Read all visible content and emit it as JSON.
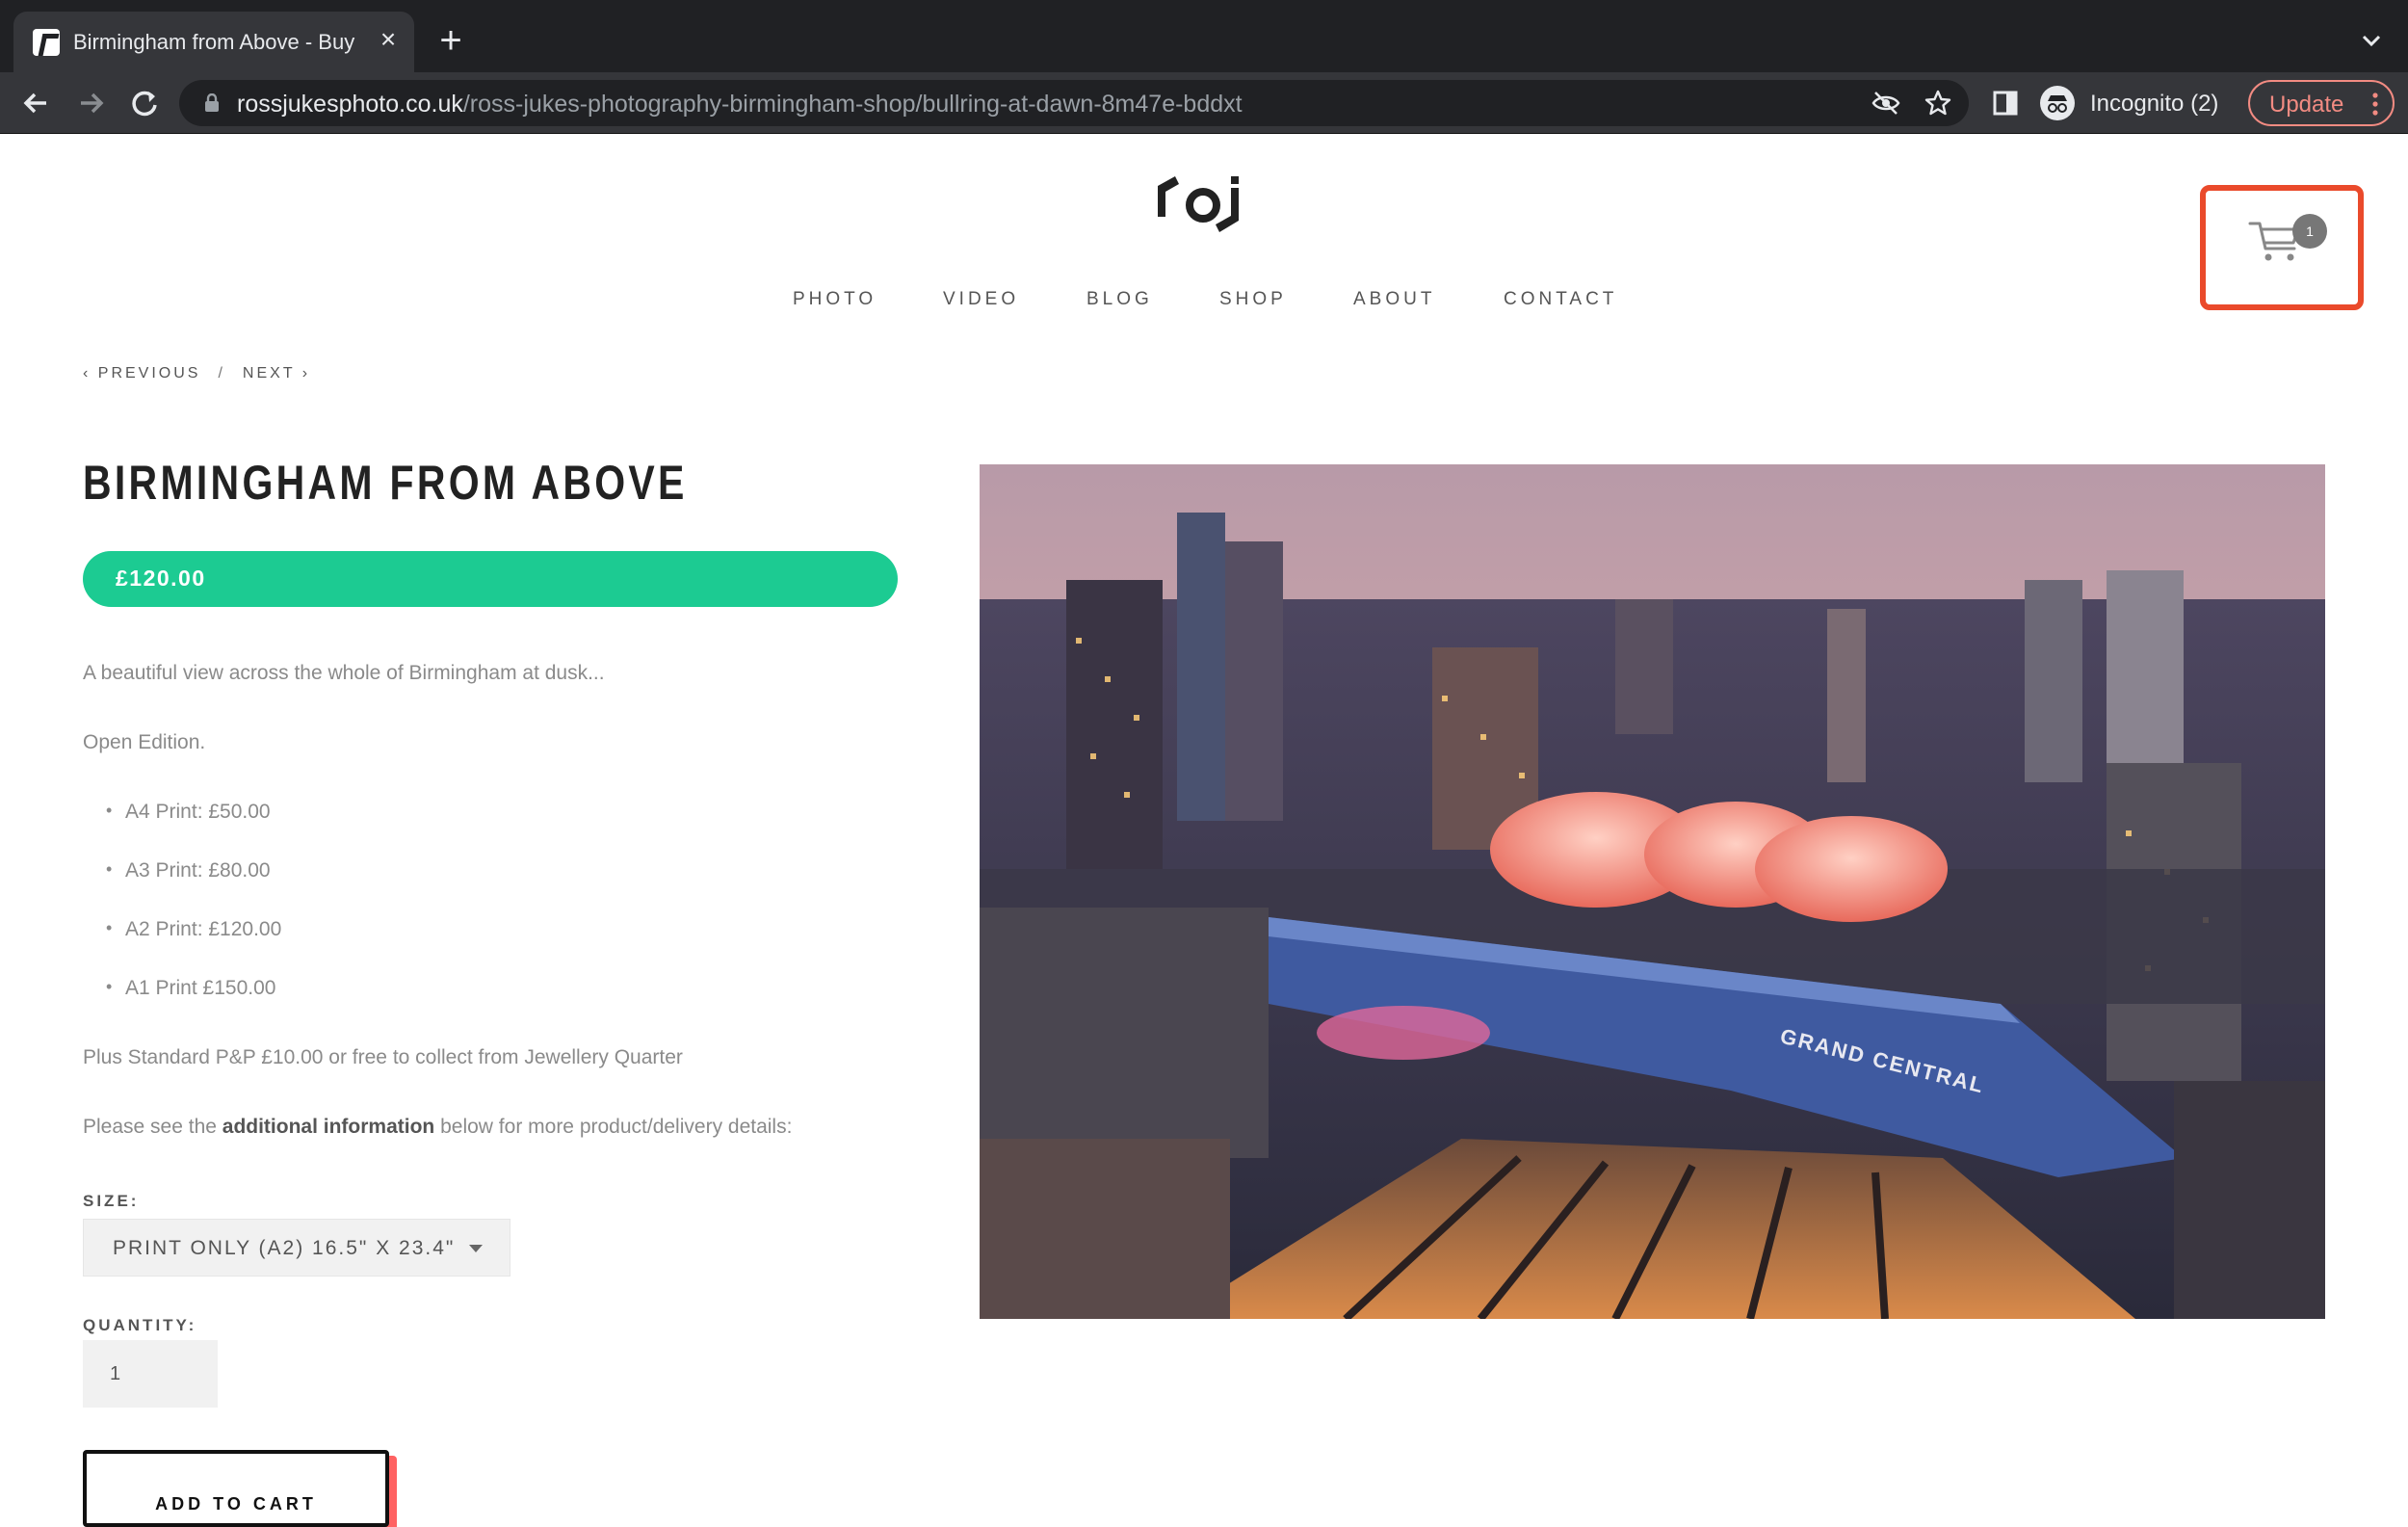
{
  "browser": {
    "tab_title": "Birmingham from Above - Buy",
    "url_host": "rossjukesphoto.co.uk",
    "url_path": "/ross-jukes-photography-birmingham-shop/bullring-at-dawn-8m47e-bddxt",
    "profile_label": "Incognito (2)",
    "update_label": "Update"
  },
  "nav": {
    "items": [
      "PHOTO",
      "VIDEO",
      "BLOG",
      "SHOP",
      "ABOUT",
      "CONTACT"
    ]
  },
  "cart": {
    "count": "1"
  },
  "pager": {
    "previous": "‹ PREVIOUS",
    "separator": "/",
    "next": "NEXT ›"
  },
  "product": {
    "title": "BIRMINGHAM FROM ABOVE",
    "price": "£120.00",
    "description": "A beautiful view across the whole of Birmingham at dusk...",
    "edition": "Open Edition.",
    "prices": [
      "A4 Print: £50.00",
      "A3 Print: £80.00",
      "A2 Print: £120.00",
      "A1 Print £150.00"
    ],
    "postage": "Plus Standard P&P £10.00 or free to collect from Jewellery Quarter",
    "info_prefix": "Please see the ",
    "info_bold": "additional information",
    "info_suffix": " below for more product/delivery details:",
    "size_label": "SIZE:",
    "size_value": "PRINT ONLY (A2) 16.5\" X 23.4\"",
    "quantity_label": "QUANTITY:",
    "quantity_value": "1",
    "add_to_cart": "ADD TO CART"
  },
  "photo": {
    "sign_text": "GRAND CENTRAL"
  },
  "colors": {
    "accent_green": "#1ccb92",
    "highlight_red": "#ea4a2b",
    "button_shadow": "#ff6262"
  }
}
